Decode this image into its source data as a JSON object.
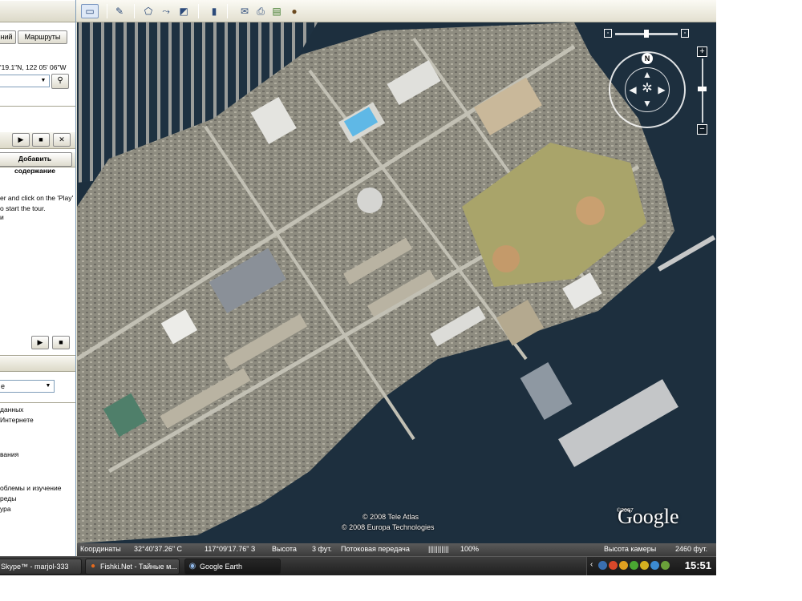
{
  "window": {
    "title": "Google Earth"
  },
  "sidebar": {
    "search_tabs": [
      "ний",
      "Маршруты"
    ],
    "coords_hint": "'19.1\"N, 122 05' 06\"W",
    "search_value": "",
    "add_content_label": "Добавить содержание",
    "tour_hint_lines": [
      "er and click on the 'Play'",
      "o start the tour.",
      "и"
    ],
    "layers_dropdown_value": "e",
    "layers_items": [
      "данных",
      "Интернете",
      "",
      "вания",
      "",
      "облемы и изучение",
      "реды",
      "ура"
    ]
  },
  "toolbar": {
    "icons": [
      "sidebar-icon",
      "placemark-icon",
      "polygon-icon",
      "path-icon",
      "overlay-icon",
      "ruler-icon",
      "email-icon",
      "print-icon",
      "maps-icon",
      "sky-icon"
    ]
  },
  "map": {
    "attribution_lines": [
      "© 2008 Tele Atlas",
      "© 2008 Europa Technologies"
    ],
    "logo": "Google",
    "logo_copyright": "©2007",
    "compass_label": "N"
  },
  "status": {
    "coords_label": "Координаты",
    "latitude": "32°40'37.26\" С",
    "longitude": "117°09'17.76\" З",
    "elevation_label": "Высота",
    "elevation_value": "3 фут.",
    "streaming_label": "Потоковая передача",
    "streaming_bar": "|||||||||||",
    "streaming_percent": "100%",
    "camera_label": "Высота камеры",
    "camera_value": "2460 фут."
  },
  "taskbar": {
    "tasks": [
      {
        "label": "Skype™ - marjol-333"
      },
      {
        "label": "Fishki.Net - Тайные м..."
      },
      {
        "label": "Google Earth"
      }
    ],
    "clock": "15:51"
  },
  "colors": {
    "water": "#1d2f3e",
    "land": "#9a9a8c",
    "field": "#a9a46a",
    "pool": "#5fb8e6",
    "taskbar": "#262626"
  }
}
